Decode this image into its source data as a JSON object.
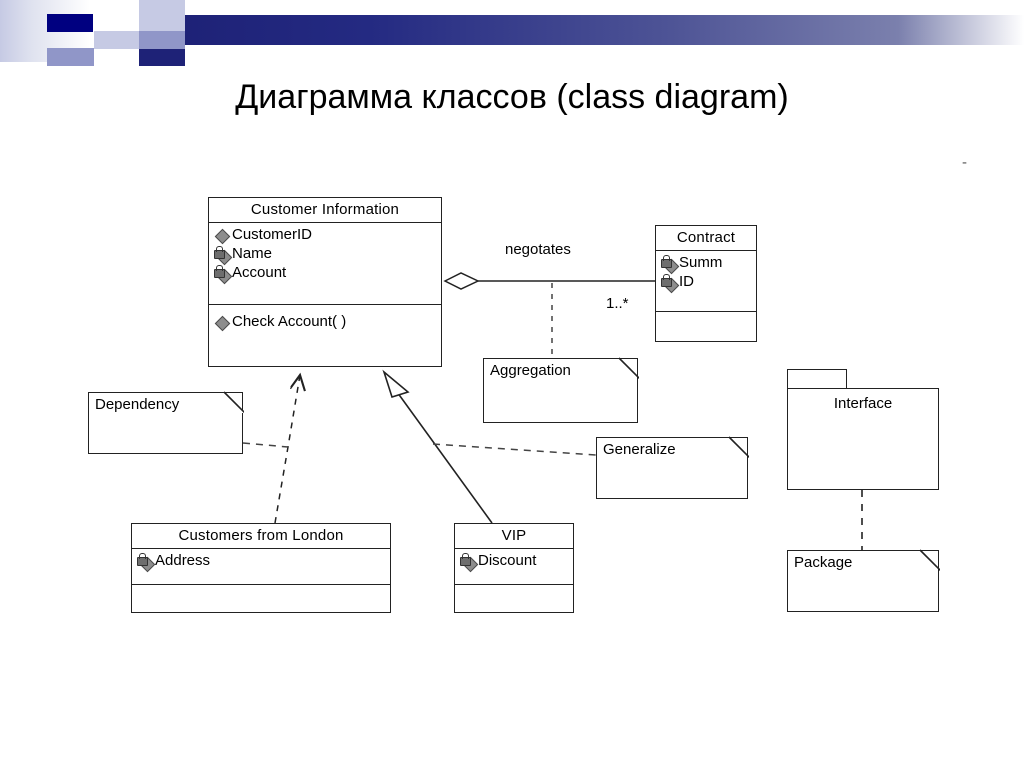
{
  "slide": {
    "title": "Диаграмма классов (class diagram)",
    "stray_mark": "-"
  },
  "theme": {
    "bar_dark": "#1e2277",
    "bar_mid": "#4e5496",
    "bar_light": "#7b80ad",
    "square_navy": "#000080",
    "square_light": "#c6cae4",
    "square_mid": "#9096c8",
    "line_color": "#222222",
    "icon_gray": "#8d8d8d"
  },
  "classes": [
    {
      "id": "customer-information",
      "name": "Customer  Information",
      "attributes": [
        {
          "label": "CustomerID",
          "visibility": "public"
        },
        {
          "label": "Name",
          "visibility": "private"
        },
        {
          "label": "Account",
          "visibility": "private"
        }
      ],
      "operations": [
        {
          "label": "Check Account( )",
          "visibility": "public"
        }
      ]
    },
    {
      "id": "contract",
      "name": "Contract",
      "attributes": [
        {
          "label": "Summ",
          "visibility": "private"
        },
        {
          "label": "ID",
          "visibility": "private"
        }
      ],
      "operations": []
    },
    {
      "id": "customers-from-london",
      "name": "Customers from London",
      "attributes": [
        {
          "label": "Address",
          "visibility": "private"
        }
      ],
      "operations": []
    },
    {
      "id": "vip",
      "name": "VIP",
      "attributes": [
        {
          "label": "Discount",
          "visibility": "private"
        }
      ],
      "operations": []
    }
  ],
  "notes": [
    {
      "id": "note-dependency",
      "text": "Dependency"
    },
    {
      "id": "note-aggregation",
      "text": "Aggregation"
    },
    {
      "id": "note-generalize",
      "text": "Generalize"
    },
    {
      "id": "note-package",
      "text": "Package"
    }
  ],
  "packages": [
    {
      "id": "package-interface",
      "text": "Interface"
    }
  ],
  "relationships": [
    {
      "id": "aggregation-customer-contract",
      "type": "aggregation",
      "label": "negotates",
      "source_multiplicity": "",
      "target_multiplicity": "1..*",
      "from": "customer-information",
      "to": "contract"
    },
    {
      "id": "generalization-vip-customer",
      "type": "generalization",
      "from": "vip",
      "to": "customer-information"
    },
    {
      "id": "dependency-london-customer",
      "type": "dependency",
      "from": "customers-from-london",
      "to": "customer-information"
    },
    {
      "id": "dependency-interface-package",
      "type": "dependency",
      "from": "package-interface",
      "to": "note-package"
    }
  ]
}
